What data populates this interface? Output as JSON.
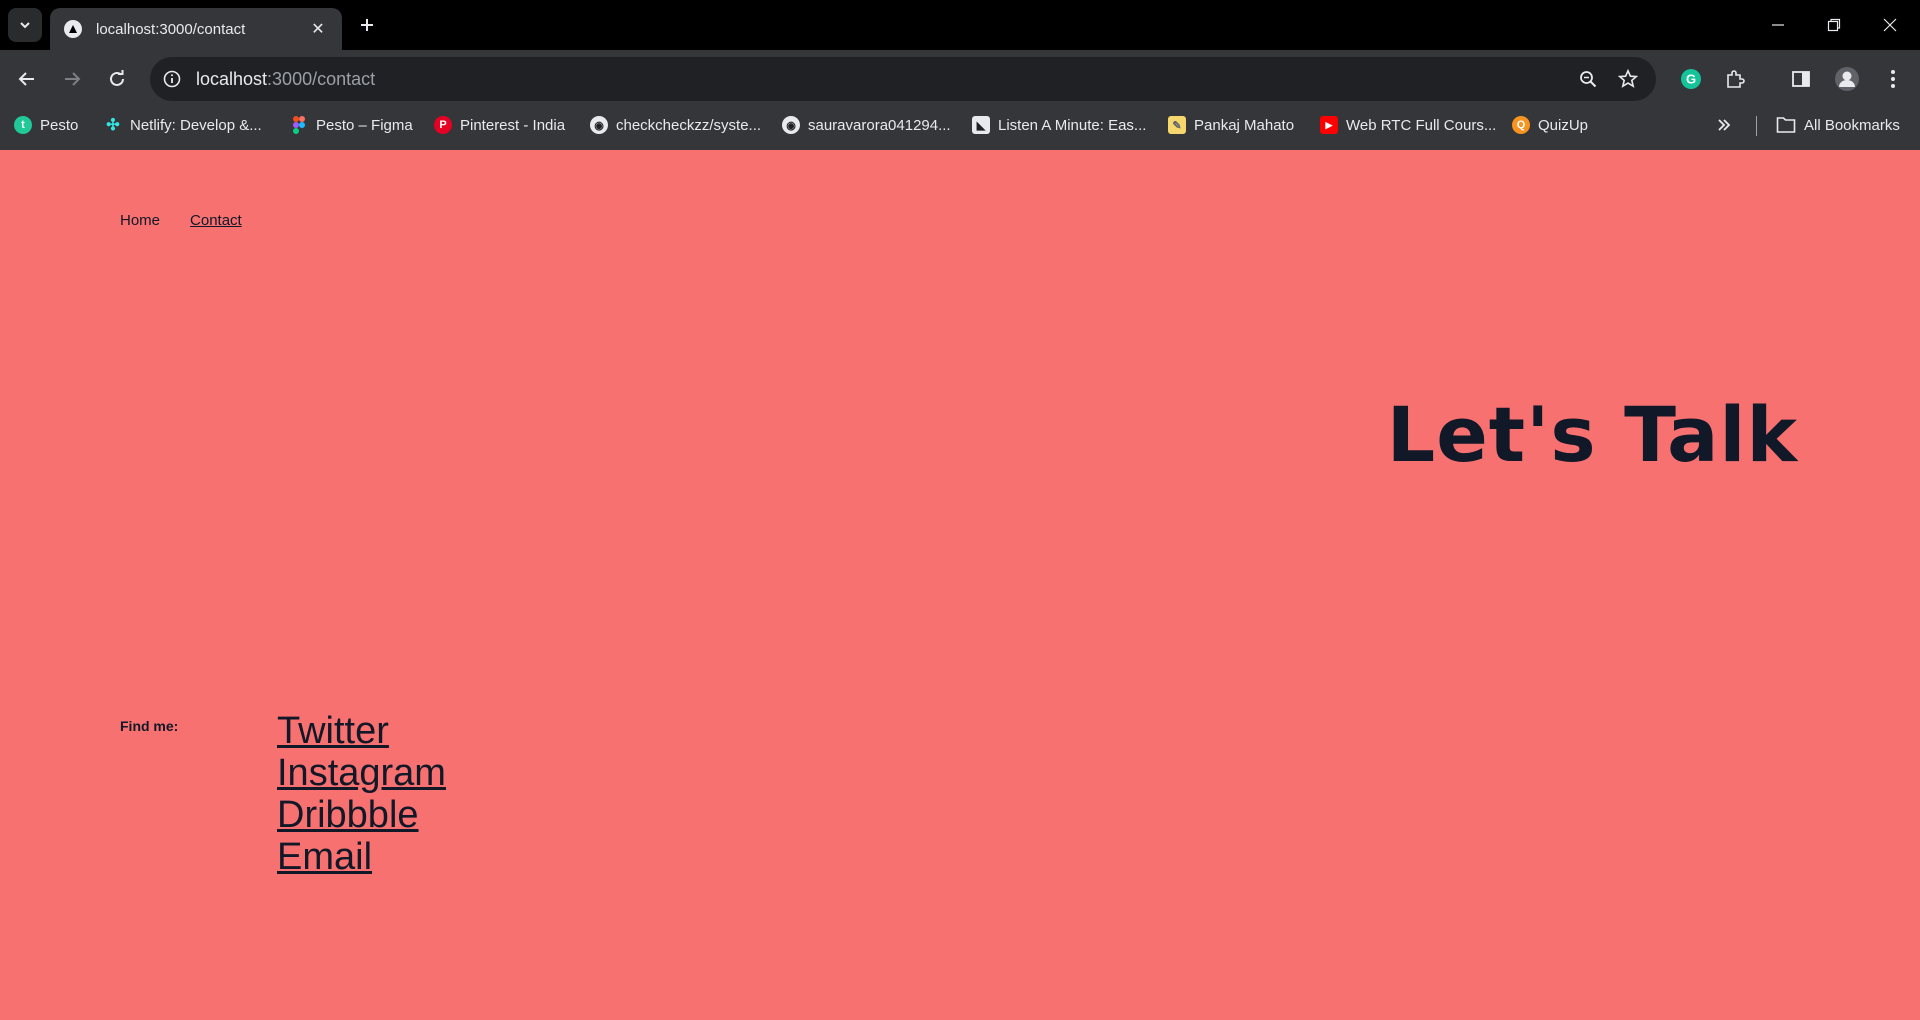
{
  "browser": {
    "tab": {
      "title": "localhost:3000/contact"
    },
    "url": {
      "host": "localhost",
      "path": ":3000/contact"
    },
    "bookmarks": [
      {
        "label": "Pesto",
        "icon": "pesto-icon",
        "color": "#20c997"
      },
      {
        "label": "Netlify: Develop &...",
        "icon": "netlify-icon",
        "color": "#32e6e2"
      },
      {
        "label": "Pesto – Figma",
        "icon": "figma-icon",
        "color": "#f24e1e"
      },
      {
        "label": "Pinterest - India",
        "icon": "pinterest-icon",
        "color": "#e60023"
      },
      {
        "label": "checkcheckzz/syste...",
        "icon": "github-icon",
        "color": "#e8eaed"
      },
      {
        "label": "sauravarora041294...",
        "icon": "github-icon",
        "color": "#e8eaed"
      },
      {
        "label": "Listen A Minute: Eas...",
        "icon": "listen-icon",
        "color": "#e8eaed"
      },
      {
        "label": "Pankaj Mahato",
        "icon": "note-icon",
        "color": "#f5d76e"
      },
      {
        "label": "Web RTC Full Cours...",
        "icon": "youtube-icon",
        "color": "#ff0000"
      },
      {
        "label": "QuizUp",
        "icon": "quizup-icon",
        "color": "#f7931e"
      }
    ],
    "all_bookmarks": "All Bookmarks"
  },
  "page": {
    "nav": {
      "home": "Home",
      "contact": "Contact"
    },
    "hero": "Let's Talk",
    "find_label": "Find me:",
    "links": {
      "twitter": "Twitter",
      "instagram": "Instagram",
      "dribbble": "Dribbble",
      "email": "Email"
    },
    "background_color": "#f87171",
    "text_color": "#111827"
  }
}
